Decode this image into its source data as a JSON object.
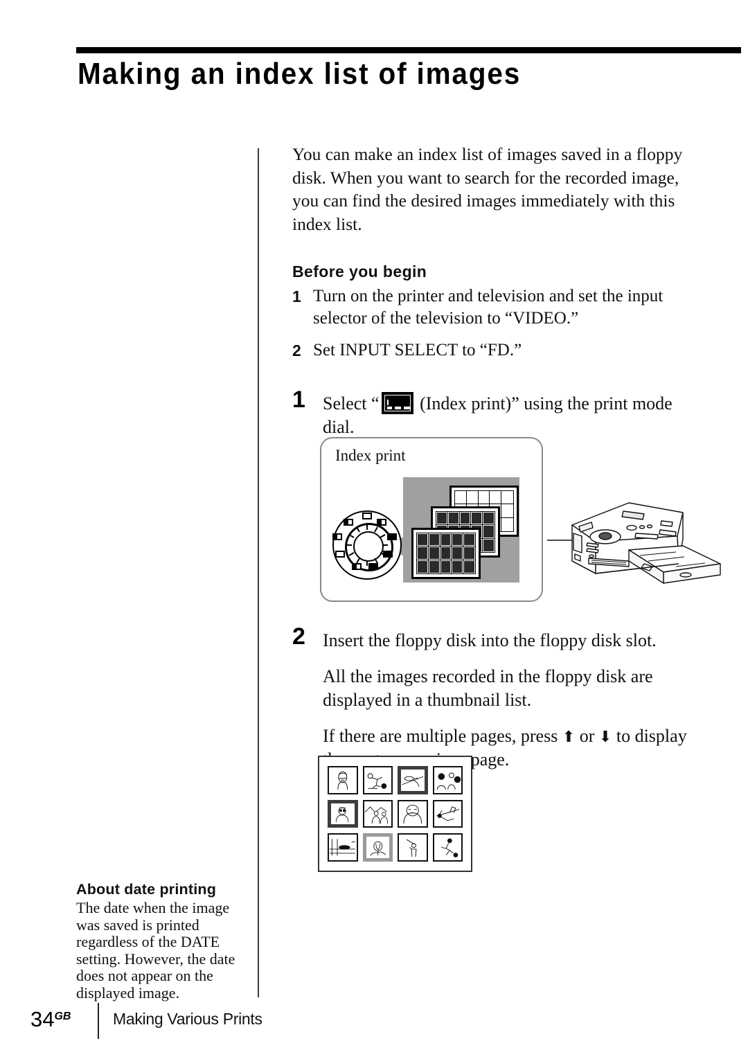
{
  "document": {
    "title": "Making an index list of images",
    "intro": "You can make an index list of images saved in a floppy disk. When you want to search for the recorded image, you can find the desired images immediately with this index list."
  },
  "before_you_begin": {
    "heading": "Before you begin",
    "steps": [
      {
        "num": "1",
        "text": "Turn on the printer and television and set the input selector of the television to “VIDEO.”"
      },
      {
        "num": "2",
        "text": "Set INPUT SELECT to “FD.”"
      }
    ]
  },
  "steps": [
    {
      "num": "1",
      "text_before_icon": "Select “",
      "icon_name": "index-print-icon",
      "text_after_icon": " (Index print)” using the print mode dial."
    },
    {
      "num": "2",
      "paragraphs": [
        "Insert the floppy disk into the floppy disk slot.",
        "All the images recorded in the floppy disk are displayed in a thumbnail list.",
        "If there are multiple pages, press ♦ or ♦ to display the next or previous page."
      ],
      "multipage_before": "If there are multiple pages, press ",
      "multipage_mid": " or ",
      "multipage_after": " to display the next or previous page.",
      "arrow_up": "⬆",
      "arrow_down": "⬇"
    }
  ],
  "illustration": {
    "label": "Index print",
    "dial_name": "print-mode-dial",
    "printer_name": "printer-device",
    "sheets": 3
  },
  "thumbnail_list": {
    "rows": 3,
    "cols": 4,
    "selected_indices": [
      2,
      4,
      9
    ]
  },
  "note": {
    "heading": "About date printing",
    "body": "The date when the image was saved is printed regardless of the DATE setting. However, the date does not appear on the displayed image."
  },
  "footer": {
    "page_number": "34",
    "page_suffix": "GB",
    "section": "Making Various Prints"
  },
  "colors": {
    "rule": "#000000",
    "divider": "#3a3a3a",
    "illus_border": "#8a8a8a",
    "illus_gray": "#a0a0a0",
    "selected_border": "#3d3d3d",
    "selected_lite_border": "#9a9a9a"
  }
}
